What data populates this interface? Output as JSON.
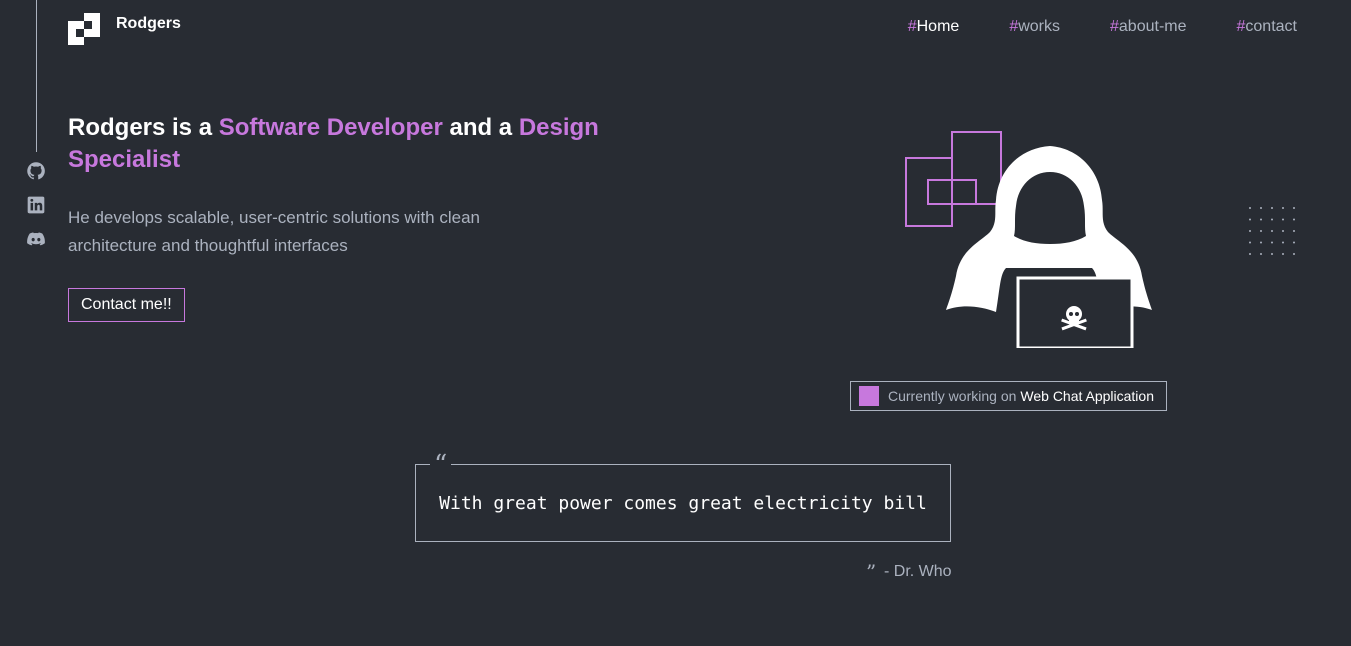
{
  "header": {
    "brand": "Rodgers",
    "nav": [
      {
        "hash": "#",
        "label": "Home"
      },
      {
        "hash": "#",
        "label": "works"
      },
      {
        "hash": "#",
        "label": "about-me"
      },
      {
        "hash": "#",
        "label": "contact"
      }
    ]
  },
  "social": [
    "github-icon",
    "linkedin-icon",
    "discord-icon"
  ],
  "hero": {
    "headline_1": "Rodgers is a ",
    "headline_accent_1": "Software Developer",
    "headline_2": " and a ",
    "headline_accent_2": "Design Specialist",
    "subtext": "He develops scalable, user-centric solutions with clean architecture and thoughtful interfaces",
    "cta": "Contact me!!"
  },
  "status": {
    "prefix": "Currently working on",
    "project": "Web Chat Application"
  },
  "quote": {
    "open_mark": "“",
    "text": "With great power comes great electricity bill",
    "close_mark": "”",
    "author": "- Dr. Who"
  },
  "colors": {
    "background": "#282c33",
    "accent": "#c778dd",
    "text": "#abb2bf",
    "heading": "#ffffff"
  }
}
